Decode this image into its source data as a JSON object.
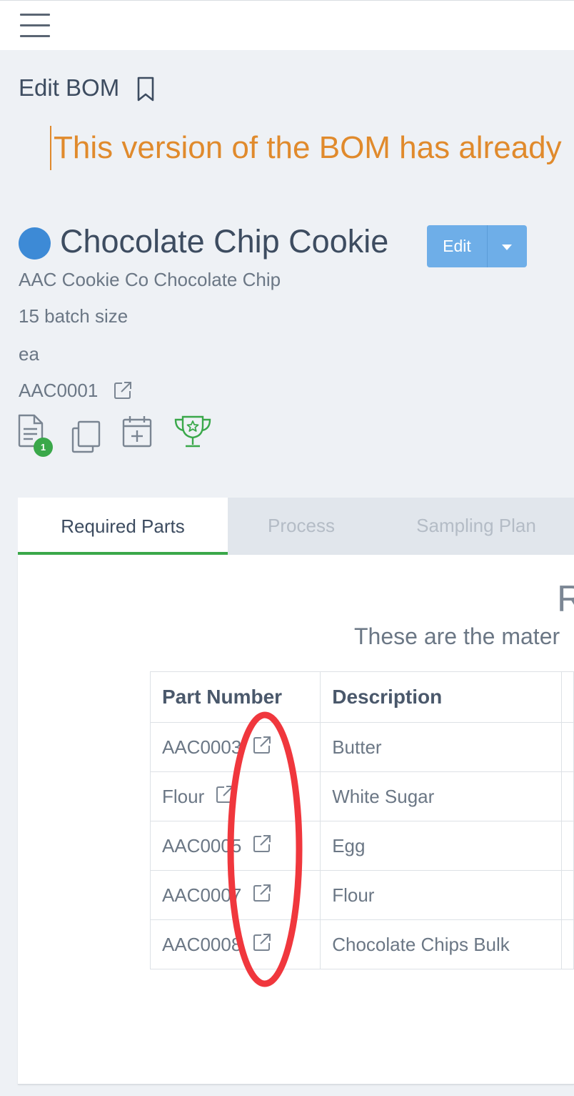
{
  "header": {
    "page_title": "Edit BOM"
  },
  "warning": {
    "text": "This version of the BOM has already"
  },
  "item": {
    "title": "Chocolate Chip Cookie",
    "subtitle": "AAC Cookie Co Chocolate Chip",
    "batch_size": "15 batch size",
    "unit": "ea",
    "part_number": "AAC0001",
    "status_color": "#3d8ad6"
  },
  "actions": {
    "edit_label": "Edit",
    "documents_badge": "1"
  },
  "tabs": [
    {
      "label": "Required Parts",
      "active": true
    },
    {
      "label": "Process",
      "active": false
    },
    {
      "label": "Sampling Plan",
      "active": false
    }
  ],
  "required_parts": {
    "heading": "R",
    "subheading": "These are the mater",
    "columns": [
      "Part Number",
      "Description"
    ],
    "rows": [
      {
        "part_number": "AAC0003",
        "description": "Butter"
      },
      {
        "part_number": "Flour",
        "description": "White Sugar"
      },
      {
        "part_number": "AAC0005",
        "description": "Egg"
      },
      {
        "part_number": "AAC0007",
        "description": "Flour"
      },
      {
        "part_number": "AAC0008",
        "description": "Chocolate Chips Bulk"
      }
    ]
  },
  "colors": {
    "accent_green": "#3aa84a",
    "warning_orange": "#e08a2c",
    "edit_button": "#6eaee8",
    "annotation_red": "#f0373d"
  }
}
